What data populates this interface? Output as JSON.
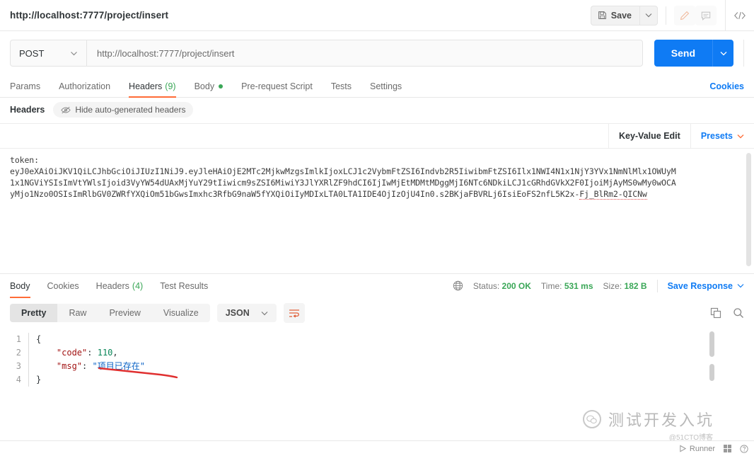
{
  "topbar": {
    "tab_url": "http://localhost:7777/project/insert",
    "save_label": "Save",
    "save_icon": "floppy-disk-icon",
    "save_caret_icon": "chevron-down-icon",
    "edit_icon": "pencil-icon",
    "comment_icon": "comment-icon",
    "code_icon": "code-brackets-icon"
  },
  "request": {
    "method": "POST",
    "method_caret_icon": "chevron-down-icon",
    "url": "http://localhost:7777/project/insert",
    "send_label": "Send",
    "send_caret_icon": "chevron-down-icon",
    "send_color": "#0f7bf4"
  },
  "request_tabs": [
    {
      "label": "Params",
      "active": false
    },
    {
      "label": "Authorization",
      "active": false
    },
    {
      "label": "Headers",
      "count": "(9)",
      "active": true
    },
    {
      "label": "Body",
      "dot": true,
      "active": false
    },
    {
      "label": "Pre-request Script",
      "active": false
    },
    {
      "label": "Tests",
      "active": false
    },
    {
      "label": "Settings",
      "active": false
    }
  ],
  "cookies_link": "Cookies",
  "headers_bar": {
    "label": "Headers",
    "hide_pill": "Hide auto-generated headers",
    "hide_pill_icon": "eye-slash-icon"
  },
  "kv_row": {
    "key_value_edit": "Key-Value Edit",
    "presets": "Presets",
    "presets_caret_icon": "chevron-down-icon"
  },
  "token": {
    "label": "token:",
    "line1": "eyJ0eXAiOiJKV1QiLCJhbGciOiJIUzI1NiJ9.eyJleHAiOjE2MTc2MjkwMzgsImlkIjoxLCJ1c2VybmFtZSI6Indvb2R5IiwibmFtZSI6Ilx1NWI4N1x1NjY3YVx1NmNlMlx1OWUyM",
    "line2": "1x1NGViYSIsImVtYWlsIjoid3VyYW54dUAxMjYuY29tIiwicm9sZSI6MiwiY3JlYXRlZF9hdCI6IjIwMjEtMDMtMDggMjI6NTc6NDkiLCJ1cGRhdGVkX2F0IjoiMjAyMS0wMy0wOCA",
    "line3a": "yMjo1Nzo0OSIsImRlbGV0ZWRfYXQiOm51bGwsImxhc3RfbG9naW5fYXQiOiIyMDIxLTA0LTA1IDE4OjIzOjU4In0.s2BKjaFBVRLj6IsiEoFS2nfL5K2x-",
    "line3b": "Fj_BlRm2-QICNw"
  },
  "response_tabs": [
    {
      "label": "Body",
      "active": true
    },
    {
      "label": "Cookies",
      "active": false
    },
    {
      "label": "Headers",
      "count": "(4)",
      "active": false
    },
    {
      "label": "Test Results",
      "active": false
    }
  ],
  "response_meta": {
    "globe_icon": "globe-icon",
    "status_label": "Status:",
    "status_value": "200 OK",
    "time_label": "Time:",
    "time_value": "531 ms",
    "size_label": "Size:",
    "size_value": "182 B",
    "save_response": "Save Response",
    "save_response_caret_icon": "chevron-down-icon",
    "status_color": "#3aa757"
  },
  "body_toolbar": {
    "segments": [
      {
        "label": "Pretty",
        "active": true
      },
      {
        "label": "Raw",
        "active": false
      },
      {
        "label": "Preview",
        "active": false
      },
      {
        "label": "Visualize",
        "active": false
      }
    ],
    "format": "JSON",
    "format_caret_icon": "chevron-down-icon",
    "wrap_icon": "word-wrap-icon",
    "copy_icon": "copy-icon",
    "search_icon": "search-icon"
  },
  "response_body": {
    "lines": [
      {
        "num": "1",
        "tokens": [
          {
            "t": "{",
            "c": "c-punc"
          }
        ]
      },
      {
        "num": "2",
        "tokens": [
          {
            "t": "    ",
            "c": "c-punc"
          },
          {
            "t": "\"code\"",
            "c": "c-key"
          },
          {
            "t": ": ",
            "c": "c-punc"
          },
          {
            "t": "110",
            "c": "c-num"
          },
          {
            "t": ",",
            "c": "c-punc"
          }
        ]
      },
      {
        "num": "3",
        "tokens": [
          {
            "t": "    ",
            "c": "c-punc"
          },
          {
            "t": "\"msg\"",
            "c": "c-key"
          },
          {
            "t": ": ",
            "c": "c-punc"
          },
          {
            "t": "\"项目已存在\"",
            "c": "c-str"
          }
        ]
      },
      {
        "num": "4",
        "tokens": [
          {
            "t": "}",
            "c": "c-punc"
          }
        ]
      }
    ]
  },
  "annotation": {
    "type": "red-underline",
    "color": "#e03030"
  },
  "watermark": {
    "text": "测试开发入坑",
    "sub": "@51CTO博客",
    "logo": "wechat-icon"
  },
  "bottombar": {
    "runner_label": "Runner",
    "runner_icon": "runner-icon",
    "grid_icon": "grid-icon",
    "help_icon": "help-icon"
  }
}
